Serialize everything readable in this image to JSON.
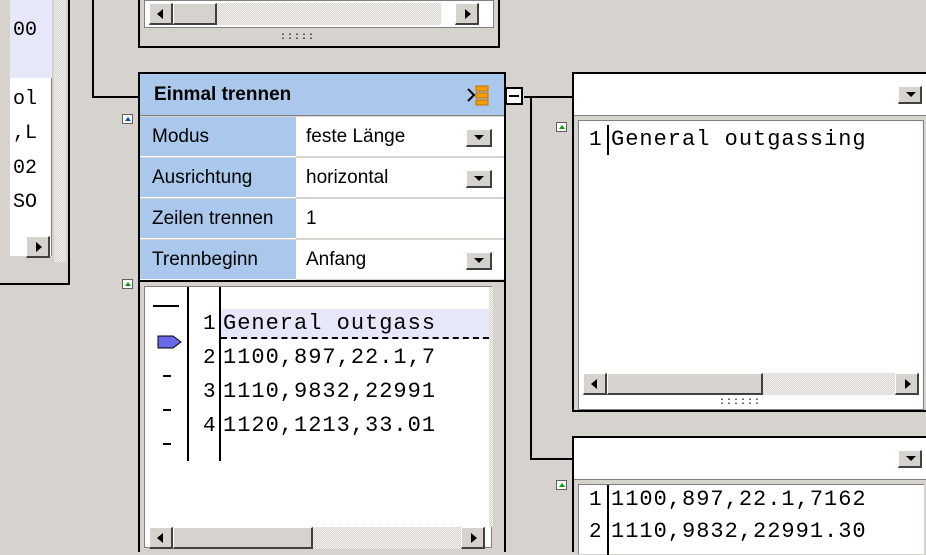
{
  "left_panel": {
    "header_text": "00",
    "lines": [
      "ol",
      ",L",
      "02",
      "SO"
    ]
  },
  "split_node": {
    "title": "Einmal trennen",
    "icon": "split-node-icon",
    "properties": [
      {
        "label": "Modus",
        "value": "feste Länge",
        "has_dropdown": true
      },
      {
        "label": "Ausrichtung",
        "value": "horizontal",
        "has_dropdown": true
      },
      {
        "label": "Zeilen trennen",
        "value": "1",
        "has_dropdown": false
      },
      {
        "label": "Trennbeginn",
        "value": "Anfang",
        "has_dropdown": true
      }
    ],
    "preview": {
      "line_numbers": [
        "1",
        "2",
        "3",
        "4"
      ],
      "lines": [
        "General outgass",
        "1100,897,22.1,7",
        "1110,9832,22991",
        "1120,1213,33.01"
      ]
    }
  },
  "output_top": {
    "line_numbers": [
      "1"
    ],
    "lines": [
      "General outgassing"
    ]
  },
  "output_bottom": {
    "line_numbers": [
      "1",
      "2"
    ],
    "lines": [
      "1100,897,22.1,7162",
      "1110,9832,22991.30"
    ]
  },
  "colors": {
    "background": "#d6d3ce",
    "node_header": "#a9c8ec",
    "preview_highlight": "#e6e8fa"
  }
}
